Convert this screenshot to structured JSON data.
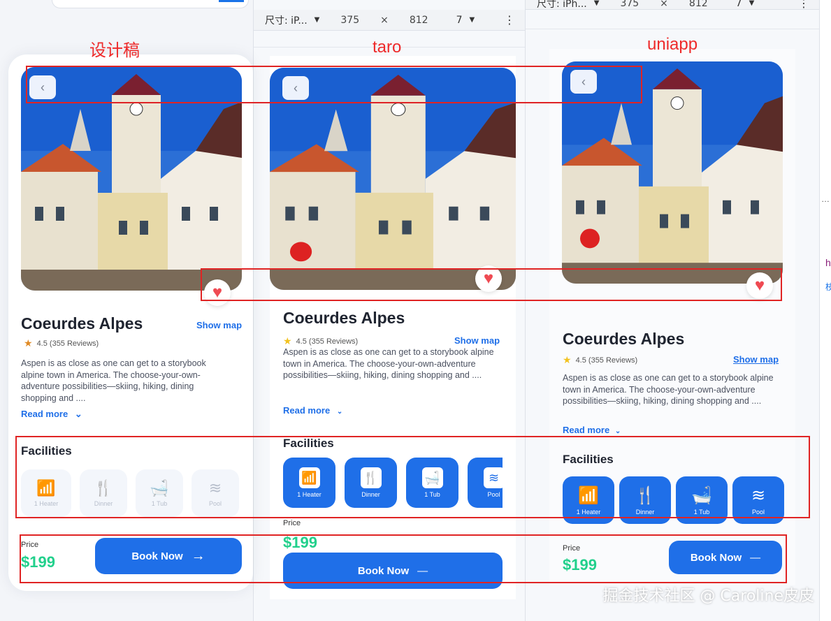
{
  "devtools": {
    "device_label": "尺寸: iP...",
    "device_label_3": "尺寸: iPh...",
    "width": "375",
    "times": "×",
    "height": "812",
    "zoom": "7",
    "menu": "⋮"
  },
  "captions": {
    "design": "设计稿",
    "taro": "taro",
    "uniapp": "uniapp"
  },
  "card": {
    "back_icon": "‹",
    "heart_icon": "♥",
    "title": "Coeurdes Alpes",
    "show_map": "Show map",
    "star_icon": "★",
    "rating": "4.5 (355 Reviews)",
    "description": "Aspen is as close as one can get to a storybook alpine town in America. The choose-your-own-adventure possibilities—skiing, hiking, dining shopping and ....",
    "read_more": "Read more",
    "read_more_chevron": "⌄",
    "facilities_title": "Facilities",
    "facilities": [
      {
        "label": "1 Heater",
        "icon": "wifi-icon",
        "glyph": "📶"
      },
      {
        "label": "Dinner",
        "icon": "cutlery-icon",
        "glyph": "🍴"
      },
      {
        "label": "1 Tub",
        "icon": "bathtub-icon",
        "glyph": "🛁"
      },
      {
        "label": "Pool",
        "icon": "pool-icon",
        "glyph": "≋"
      }
    ],
    "price_label": "Price",
    "price": "$199",
    "book_now": "Book Now",
    "arrow_icon": "→",
    "dash_icon": "—"
  },
  "colors": {
    "accent": "#1f6fe8",
    "price": "#22d08c",
    "annotation": "#e02424",
    "heart": "#ef4a52"
  },
  "watermark": "掘金技术社区 @ Caroline皮皮",
  "side_letters": {
    "a": "h",
    "b": "枝"
  }
}
